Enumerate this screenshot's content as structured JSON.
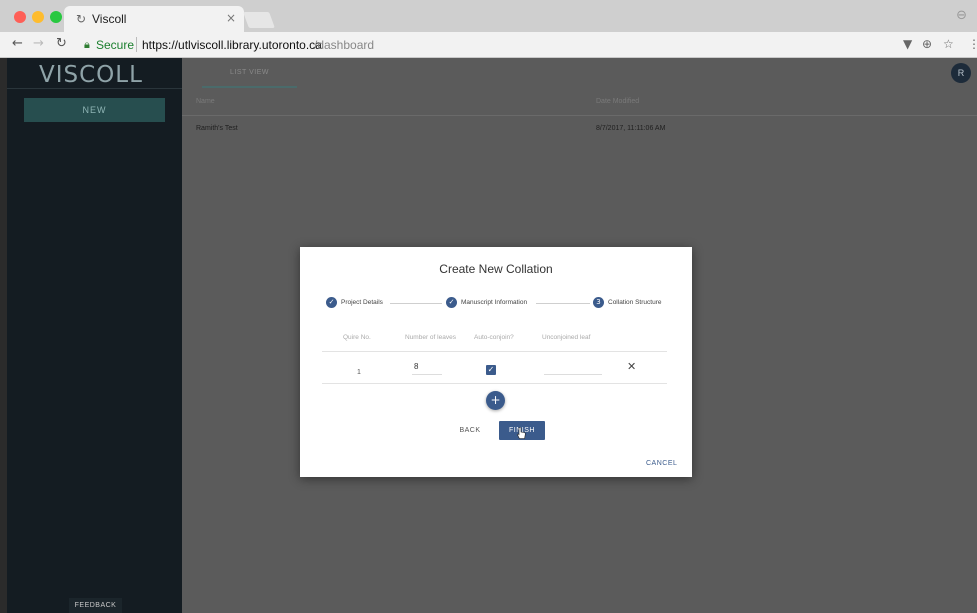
{
  "browser": {
    "tab_title": "Viscoll",
    "tab_close": "×",
    "tab_favicon": "↻",
    "secure_label": "Secure",
    "url_host": "https://utlviscoll.library.utoronto.ca",
    "url_path": "/dashboard",
    "icons": [
      "back-arrow-icon",
      "forward-arrow-icon",
      "reload-icon",
      "lock-icon",
      "filter-icon",
      "zoom-icon",
      "star-icon",
      "menu-icon"
    ]
  },
  "sidebar": {
    "logo": "VISCOLL",
    "new_label": "NEW",
    "feedback_label": "FEEDBACK"
  },
  "main": {
    "view_tab": "LIST VIEW",
    "avatar_initial": "R",
    "columns": {
      "name": "Name",
      "date": "Date Modified"
    },
    "rows": [
      {
        "name": "Ramith's Test",
        "date": "8/7/2017, 11:11:06 AM"
      }
    ]
  },
  "modal": {
    "title": "Create New Collation",
    "steps": [
      {
        "label": "Project Details",
        "icon": "check-circle-icon",
        "glyph": "✓"
      },
      {
        "label": "Manuscript Information",
        "icon": "check-circle-icon",
        "glyph": "✓"
      },
      {
        "label": "Collation Structure",
        "icon": "step-number-icon",
        "glyph": "3"
      }
    ],
    "table_headers": {
      "quire": "Quire No.",
      "leaves": "Number of leaves",
      "auto": "Auto-conjoin?",
      "uncon": "Unconjoined leaf"
    },
    "row": {
      "quire": "1",
      "leaves": "8",
      "auto_checked": true,
      "uncon": ""
    },
    "add_label": "+",
    "back_label": "BACK",
    "finish_label": "FINISH",
    "cancel_label": "CANCEL"
  },
  "colors": {
    "accent": "#3b5b8c",
    "sidebar_bg": "#141c22",
    "new_button": "#274e4f",
    "overlay": "#5b5b5b"
  }
}
